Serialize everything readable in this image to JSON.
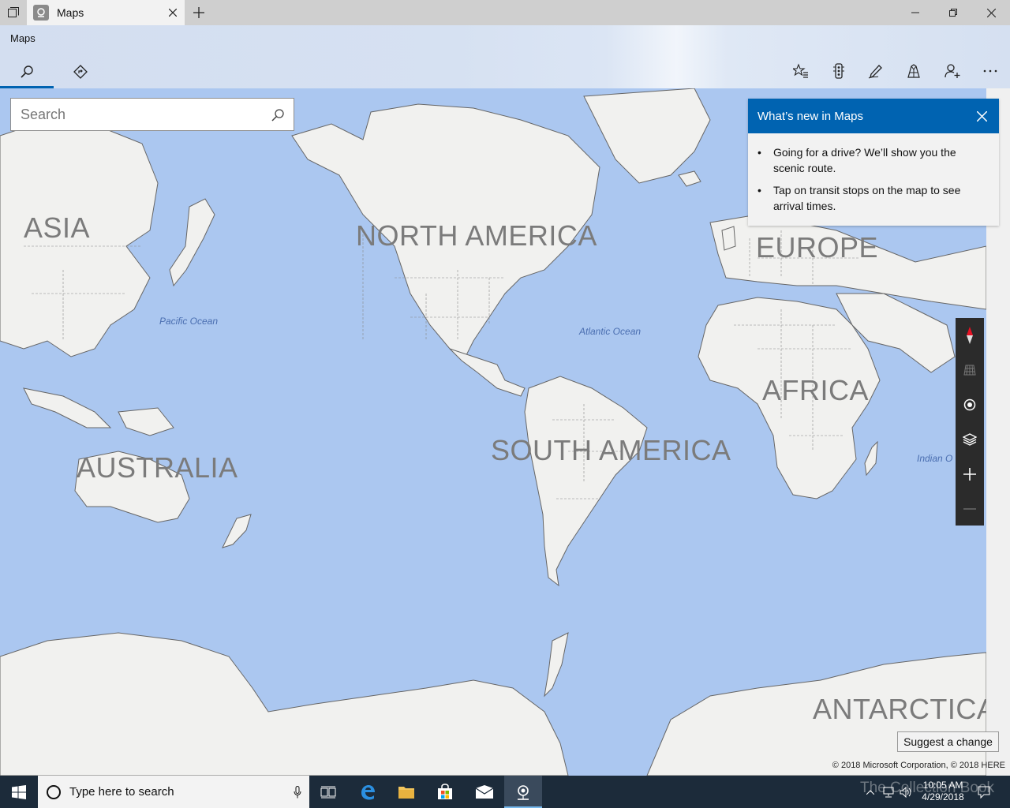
{
  "titlebar": {
    "tab_title": "Maps",
    "new_tab": "+"
  },
  "header": {
    "app_title": "Maps"
  },
  "search": {
    "placeholder": "Search"
  },
  "map_labels": {
    "asia": "ASIA",
    "north_america": "NORTH AMERICA",
    "europe": "EUROPE",
    "africa": "AFRICA",
    "south_america": "SOUTH AMERICA",
    "australia": "AUSTRALIA",
    "antarctica": "ANTARCTICA",
    "pacific": "Pacific Ocean",
    "atlantic": "Atlantic Ocean",
    "indian": "Indian O"
  },
  "whats_new": {
    "title": "What’s new in Maps",
    "items": [
      "Going for a drive? We’ll show you the scenic route.",
      "Tap on transit stops on the map to see arrival times."
    ]
  },
  "suggest_label": "Suggest a change",
  "copyright": "© 2018 Microsoft Corporation, © 2018 HERE",
  "taskbar": {
    "search_placeholder": "Type here to search",
    "time": "10:05 AM",
    "date": "4/29/2018",
    "watermark": "The Collection Book"
  },
  "colors": {
    "accent": "#0063b1",
    "water": "#abc7f0",
    "land": "#f1f1ef",
    "taskbar": "#1c2b3a"
  },
  "icons": [
    "search-icon",
    "directions-icon",
    "favorites-icon",
    "traffic-icon",
    "ink-icon",
    "3d-cities-icon",
    "account-icon",
    "more-icon",
    "compass-icon",
    "tilt-icon",
    "location-icon",
    "layers-icon",
    "zoom-in-icon",
    "zoom-out-icon"
  ]
}
